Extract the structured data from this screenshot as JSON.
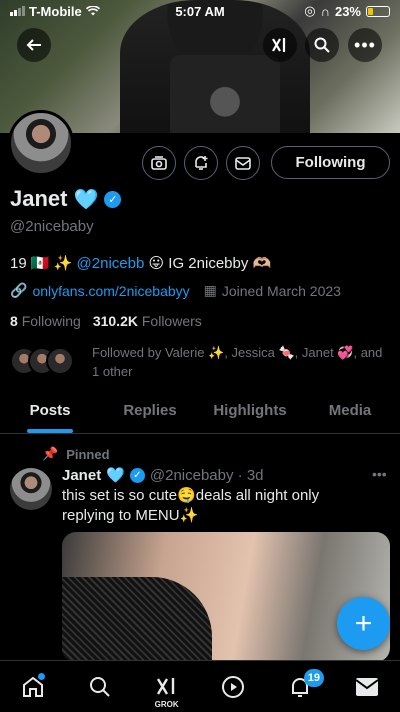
{
  "status_bar": {
    "carrier": "T-Mobile",
    "time": "5:07 AM",
    "battery": "23%",
    "battery_level": 0.23
  },
  "profile": {
    "name": "Janet",
    "name_emoji": "🩵",
    "handle": "@2nicebaby",
    "bio_prefix": "19 🇲🇽 ✨",
    "bio_mention": "@2nicebb",
    "bio_suffix": "😛 IG 2nicebby 🫶🏼",
    "website": "onlyfans.com/2nicebabyy",
    "joined": "Joined March 2023",
    "following_count": "8",
    "following_label": "Following",
    "followers_count": "310.2K",
    "followers_label": "Followers",
    "followed_by": "Followed by Valerie ✨, Jessica 🍬, Janet 💞, and 1 other",
    "follow_button": "Following"
  },
  "tabs": [
    {
      "label": "Posts",
      "active": true
    },
    {
      "label": "Replies",
      "active": false
    },
    {
      "label": "Highlights",
      "active": false
    },
    {
      "label": "Media",
      "active": false
    }
  ],
  "tweet": {
    "pinned_label": "Pinned",
    "author": "Janet",
    "author_emoji": "🩵",
    "handle_time": "@2nicebaby · 3d",
    "text": "this set is so cute🤤deals all night only replying to MENU✨"
  },
  "nav": {
    "grok_label": "GROK",
    "notifications_badge": "19"
  },
  "colors": {
    "accent": "#1d9bf0",
    "background": "#000000",
    "muted": "#71767b"
  }
}
